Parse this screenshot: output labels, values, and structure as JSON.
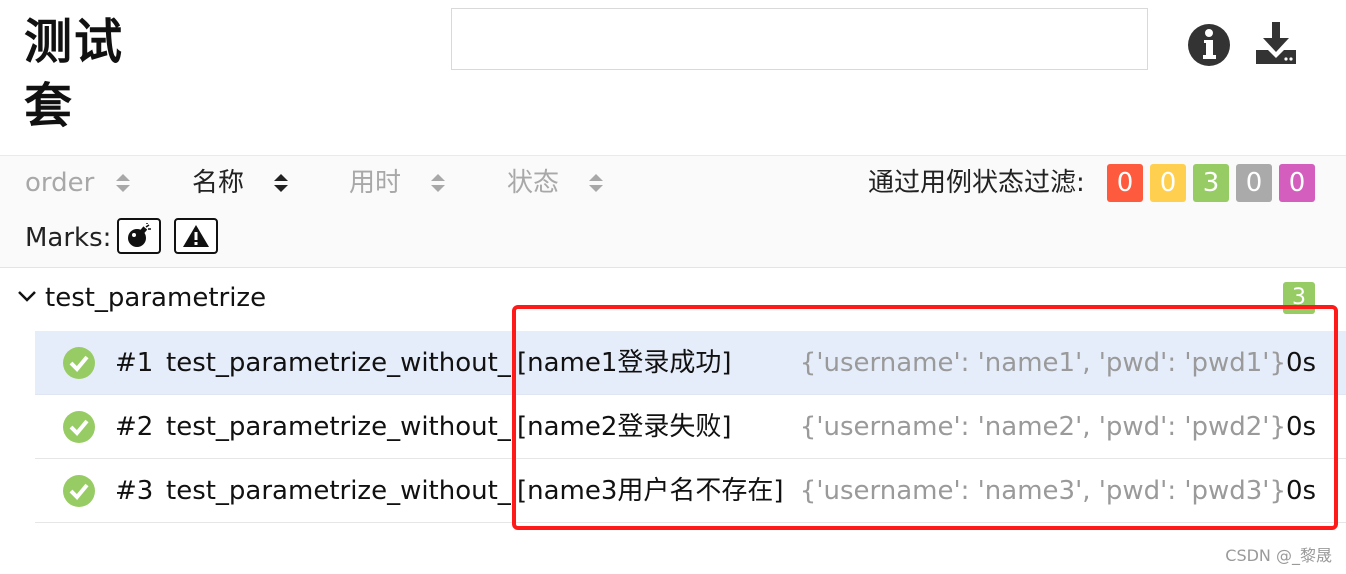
{
  "header": {
    "title": "测试套",
    "search": {
      "value": "",
      "placeholder": ""
    },
    "info_icon": "info-icon",
    "download_icon": "download-icon"
  },
  "toolbar": {
    "sort_columns": [
      {
        "label": "order",
        "active": false
      },
      {
        "label": "名称",
        "active": true
      },
      {
        "label": "用时",
        "active": false
      },
      {
        "label": "状态",
        "active": false
      }
    ],
    "filter_label": "通过用例状态过滤:",
    "status_filters": [
      {
        "count": "0",
        "color": "#fd5a3e"
      },
      {
        "count": "0",
        "color": "#ffd050"
      },
      {
        "count": "3",
        "color": "#97cc64"
      },
      {
        "count": "0",
        "color": "#aaaaaa"
      },
      {
        "count": "0",
        "color": "#d35ebe"
      }
    ],
    "marks_label": "Marks:",
    "marks": [
      "bomb-icon",
      "warning-icon"
    ]
  },
  "group": {
    "name": "test_parametrize",
    "count": "3"
  },
  "cases": [
    {
      "num": "#1",
      "name": "test_parametrize_without_id",
      "param": "[name1登录成功]",
      "args": "{'username': 'name1', 'pwd': 'pwd1'}",
      "duration": "0s",
      "status": "passed",
      "selected": true
    },
    {
      "num": "#2",
      "name": "test_parametrize_without_id",
      "param": "[name2登录失败]",
      "args": "{'username': 'name2', 'pwd': 'pwd2'}",
      "duration": "0s",
      "status": "passed",
      "selected": false
    },
    {
      "num": "#3",
      "name": "test_parametrize_without_id",
      "param": "[name3用户名不存在]",
      "args": "{'username': 'name3', 'pwd': 'pwd3'}",
      "duration": "0s",
      "status": "passed",
      "selected": false
    }
  ],
  "watermark": "CSDN @_黎晟",
  "colors": {
    "passed": "#97cc64",
    "selected_row": "#e6edfa",
    "highlight_box": "#ff1a1a"
  }
}
